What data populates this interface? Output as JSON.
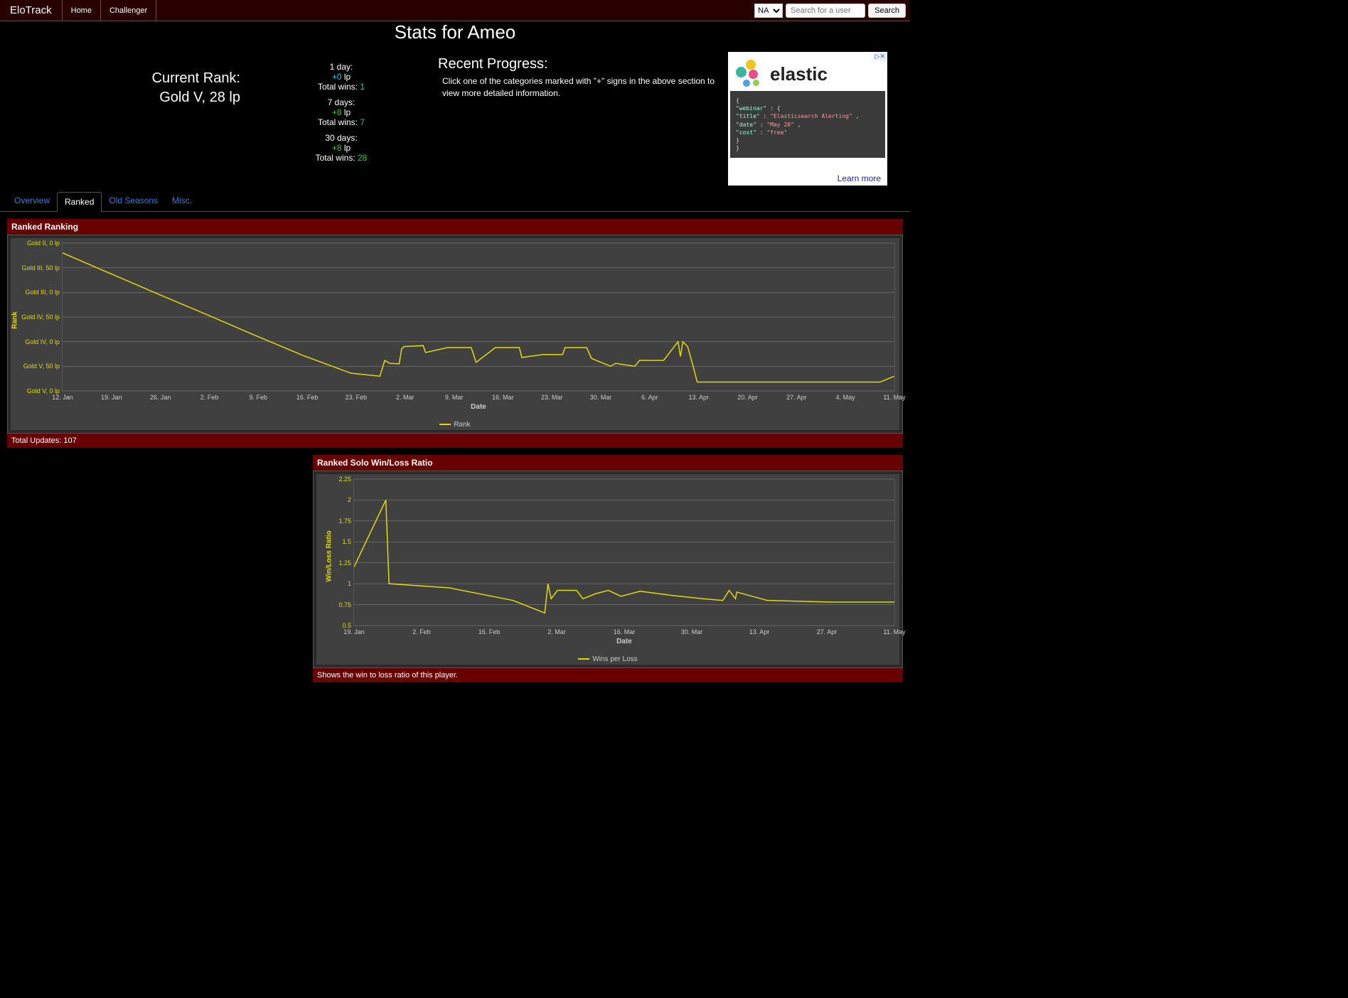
{
  "nav": {
    "brand": "EloTrack",
    "links": [
      "Home",
      "Challenger"
    ],
    "region_selected": "NA",
    "search_placeholder": "Search for a user",
    "search_button": "Search"
  },
  "page_title": "Stats for Ameo",
  "current_rank": {
    "label": "Current Rank:",
    "value": "Gold V, 28 lp"
  },
  "recent_progress": {
    "title": "Recent Progress:",
    "desc": "Click one of the categories marked with \"+\" signs in the above section to view more detailed information.",
    "blocks": [
      {
        "period": "1 day:",
        "lp": "+0",
        "wins_label": "Total wins:",
        "wins": "1"
      },
      {
        "period": "7 days:",
        "lp": "+8",
        "wins_label": "Total wins:",
        "wins": "7"
      },
      {
        "period": "30 days:",
        "lp": "+8",
        "wins_label": "Total wins:",
        "wins": "28"
      }
    ]
  },
  "ad": {
    "title": "elastic",
    "code_lines": [
      "{",
      "   \"webinar\" : {",
      "      \"title\" : \"Elasticsearch Alerting\"  ,",
      "      \"date\"  : \"May 20\"   ,",
      "      \"cost\"  : \"free\"",
      "   }",
      "}"
    ],
    "cta": "Learn more"
  },
  "tabs": [
    "Overview",
    "Ranked",
    "Old Seasons",
    "Misc."
  ],
  "active_tab": "Ranked",
  "panel1": {
    "title": "Ranked Ranking",
    "footer": "Total Updates: 107"
  },
  "panel2": {
    "title": "Ranked Solo Win/Loss Ratio",
    "footer": "Shows the win to loss ratio of this player."
  },
  "chart_data": [
    {
      "type": "line",
      "title": "Ranked Ranking",
      "xlabel": "Date",
      "ylabel": "Rank",
      "legend": "Rank",
      "x_ticks": [
        "12. Jan",
        "19. Jan",
        "26. Jan",
        "2. Feb",
        "9. Feb",
        "16. Feb",
        "23. Feb",
        "2. Mar",
        "9. Mar",
        "16. Mar",
        "23. Mar",
        "30. Mar",
        "6. Apr",
        "13. Apr",
        "20. Apr",
        "27. Apr",
        "4. May",
        "11. May"
      ],
      "y_ticks": [
        "Gold V, 0 lp",
        "Gold V, 50 lp",
        "Gold IV, 0 lp",
        "Gold IV, 50 lp",
        "Gold III, 0 lp",
        "Gold III, 50 lp",
        "Gold II, 0 lp"
      ],
      "ylim": [
        0,
        300
      ],
      "series": [
        {
          "name": "Rank",
          "x": [
            0,
            1,
            2,
            3,
            4,
            5,
            6,
            6.6,
            6.7,
            6.8,
            7.0,
            7.05,
            7.1,
            7.5,
            7.55,
            8.0,
            8.5,
            8.6,
            9.0,
            9.5,
            9.55,
            10.0,
            10.4,
            10.45,
            10.9,
            11.0,
            11.4,
            11.5,
            11.9,
            12.0,
            12.5,
            12.8,
            12.85,
            12.9,
            13.0,
            13.1,
            13.2,
            13.5,
            14.3,
            17.0,
            17.3
          ],
          "y": [
            280,
            238,
            196,
            155,
            113,
            72,
            36,
            30,
            62,
            56,
            55,
            85,
            90,
            92,
            78,
            88,
            88,
            58,
            88,
            88,
            68,
            74,
            74,
            88,
            88,
            66,
            50,
            56,
            50,
            62,
            62,
            100,
            70,
            100,
            90,
            55,
            18,
            18,
            18,
            18,
            30
          ]
        }
      ]
    },
    {
      "type": "line",
      "title": "Ranked Solo Win/Loss Ratio",
      "xlabel": "Date",
      "ylabel": "Win/Loss Ratio",
      "legend": "Wins per Loss",
      "x_ticks": [
        "19. Jan",
        "2. Feb",
        "16. Feb",
        "2. Mar",
        "16. Mar",
        "30. Mar",
        "13. Apr",
        "27. Apr",
        "11. May"
      ],
      "ylim": [
        0.5,
        2.25
      ],
      "y_ticks": [
        "0.5",
        "0.75",
        "1",
        "1.25",
        "1.5",
        "1.75",
        "2",
        "2.25"
      ],
      "series": [
        {
          "name": "Wins per Loss",
          "x": [
            0,
            0.5,
            0.55,
            1.5,
            2.5,
            3.0,
            3.05,
            3.1,
            3.2,
            3.5,
            3.6,
            3.8,
            4.0,
            4.2,
            4.5,
            5.0,
            5.5,
            5.8,
            5.9,
            6.0,
            6.02,
            6.5,
            7.5,
            8.5
          ],
          "y": [
            1.2,
            2.0,
            1.0,
            0.95,
            0.8,
            0.65,
            1.0,
            0.82,
            0.92,
            0.92,
            0.82,
            0.88,
            0.92,
            0.85,
            0.91,
            0.86,
            0.82,
            0.8,
            0.92,
            0.82,
            0.9,
            0.8,
            0.78,
            0.78
          ]
        }
      ]
    }
  ]
}
